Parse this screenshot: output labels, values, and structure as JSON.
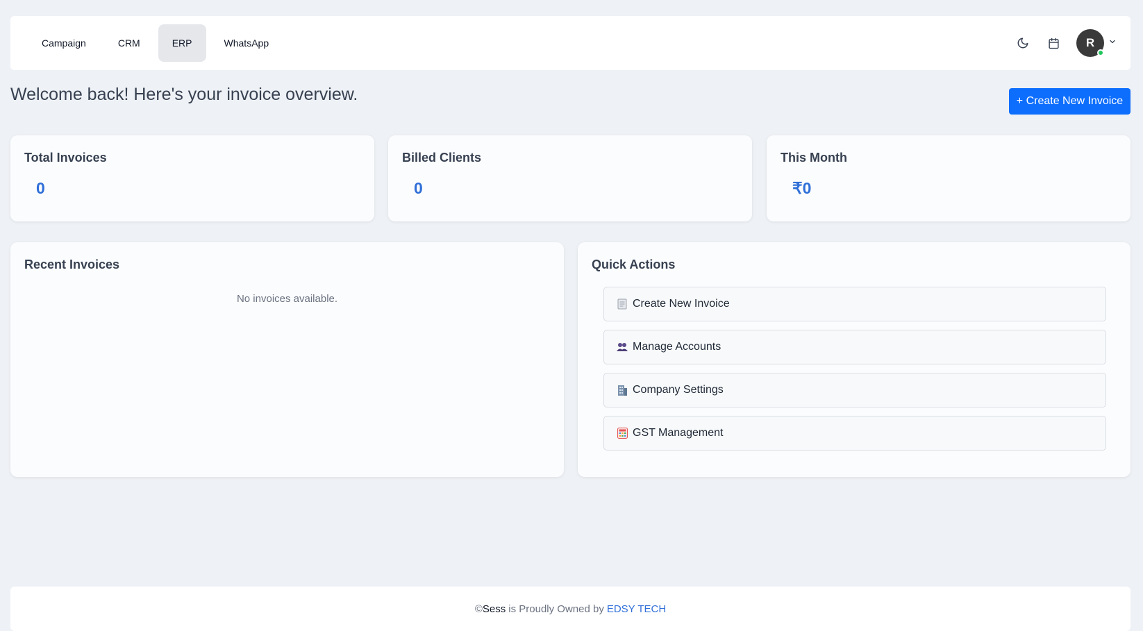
{
  "nav": {
    "items": [
      {
        "label": "Campaign",
        "active": false
      },
      {
        "label": "CRM",
        "active": false
      },
      {
        "label": "ERP",
        "active": true
      },
      {
        "label": "WhatsApp",
        "active": false
      }
    ],
    "theme_icon": "moon-icon",
    "calendar_icon": "calendar-icon",
    "avatar_initial": "R",
    "avatar_status": "online",
    "avatar_menu_icon": "chevron-down-icon"
  },
  "header": {
    "welcome": "Welcome back! Here's your invoice overview.",
    "create_button": "+ Create New Invoice"
  },
  "stats": [
    {
      "title": "Total Invoices",
      "value": "0"
    },
    {
      "title": "Billed Clients",
      "value": "0"
    },
    {
      "title": "This Month",
      "value": "₹0"
    }
  ],
  "recent_invoices": {
    "title": "Recent Invoices",
    "empty_message": "No invoices available."
  },
  "quick_actions": {
    "title": "Quick Actions",
    "items": [
      {
        "label": "Create New Invoice",
        "icon": "receipt-icon"
      },
      {
        "label": "Manage Accounts",
        "icon": "users-icon"
      },
      {
        "label": "Company Settings",
        "icon": "building-icon"
      },
      {
        "label": "GST Management",
        "icon": "calculator-icon"
      }
    ]
  },
  "footer": {
    "prefix": "©",
    "brand": "Sess",
    "middle": "is Proudly Owned by",
    "owner": "EDSY TECH"
  },
  "colors": {
    "primary": "#0d6efd",
    "stat_value": "#2f6fd8",
    "background": "#eef1f5",
    "online": "#22c55e"
  }
}
